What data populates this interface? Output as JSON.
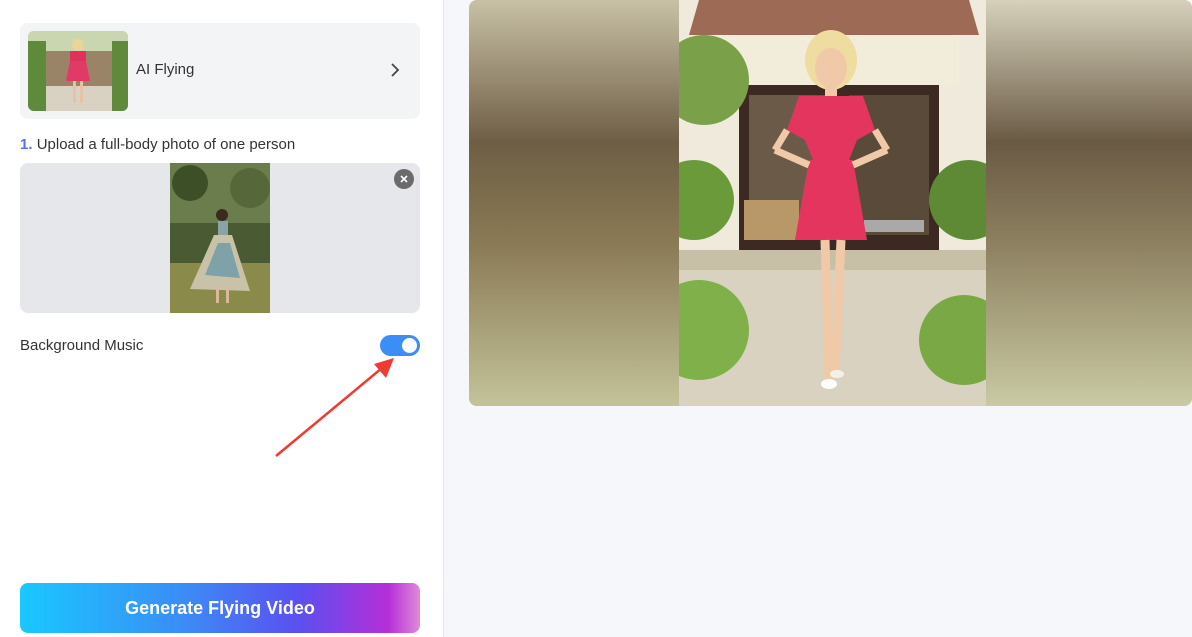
{
  "effect": {
    "name": "AI Flying"
  },
  "upload": {
    "step_number": "1.",
    "step_text": "Upload a full-body photo of one person"
  },
  "music": {
    "label": "Background Music",
    "enabled": true
  },
  "generate": {
    "label": "Generate Flying Video"
  },
  "colors": {
    "accent": "#3a8ef6",
    "step_number": "#5b6cf0"
  }
}
